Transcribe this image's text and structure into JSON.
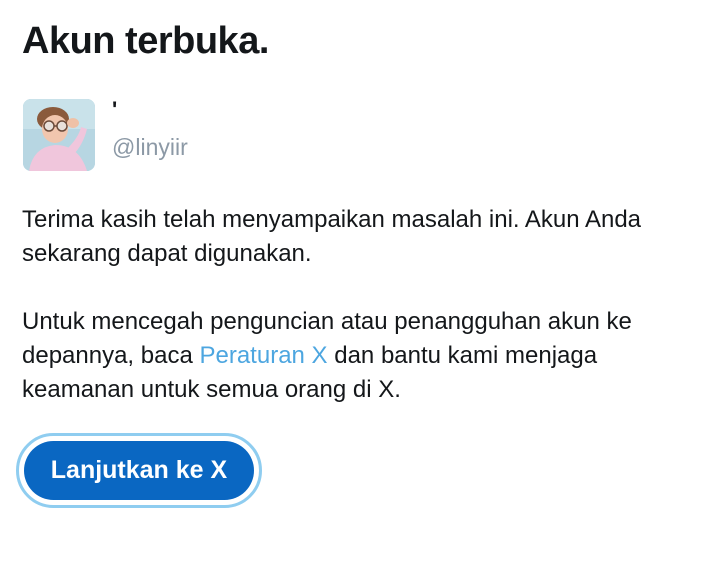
{
  "title": "Akun terbuka.",
  "profile": {
    "display_name": "'",
    "handle": "@linyiir",
    "avatar_icon": "user-avatar-photo"
  },
  "message": {
    "paragraph1": "Terima kasih telah menyampaikan masalah ini. Akun Anda sekarang dapat digunakan.",
    "paragraph2_before": "Untuk mencegah penguncian atau penangguhan akun ke depannya, baca ",
    "paragraph2_link": "Peraturan X",
    "paragraph2_after": " dan bantu kami menjaga keamanan untuk semua orang di X."
  },
  "button": {
    "label": "Lanjutkan ke X"
  },
  "colors": {
    "primary_button": "#0a67c2",
    "button_focus_ring": "#8fcdf0",
    "link": "#4da6e0",
    "handle_text": "#8c99a6",
    "text": "#14171a"
  }
}
